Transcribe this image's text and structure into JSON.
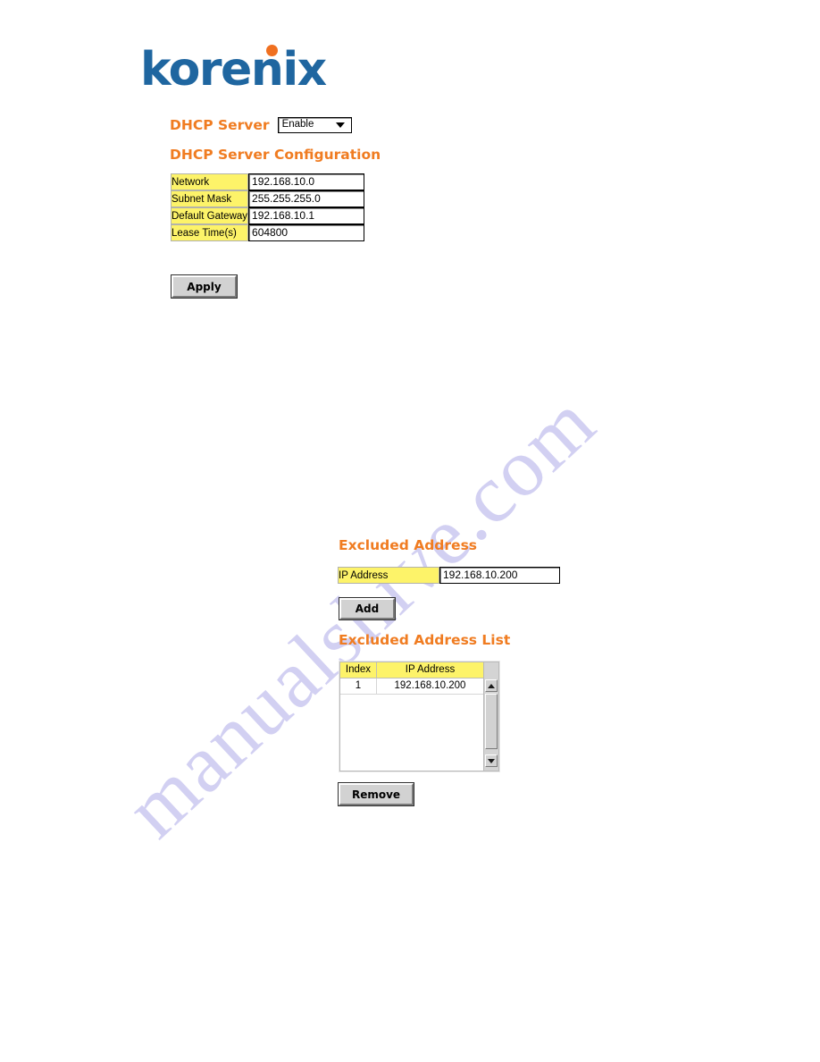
{
  "brand": {
    "logo_text": "korenix",
    "logo_blue": "#1f66a0",
    "logo_dot_color": "#f07020"
  },
  "watermark": {
    "text": "manualshive.com",
    "color": "#d2d0f2"
  },
  "theme": {
    "heading_orange": "#f07c21",
    "label_yellow": "#fdf369",
    "button_face": "#d2d2d2"
  },
  "dhcp_server": {
    "label": "DHCP Server",
    "select_value": "Enable",
    "options": [
      "Enable"
    ]
  },
  "dhcp_config": {
    "title": "DHCP Server Configuration",
    "rows": [
      {
        "label": "Network",
        "value": "192.168.10.0"
      },
      {
        "label": "Subnet Mask",
        "value": "255.255.255.0"
      },
      {
        "label": "Default Gateway",
        "value": "192.168.10.1"
      },
      {
        "label": "Lease Time(s)",
        "value": "604800"
      }
    ],
    "apply_label": "Apply"
  },
  "excluded_address": {
    "title": "Excluded Address",
    "ip_label": "IP Address",
    "ip_value": "192.168.10.200",
    "add_label": "Add"
  },
  "excluded_list": {
    "title": "Excluded Address List",
    "columns": [
      "Index",
      "IP Address"
    ],
    "rows": [
      {
        "index": "1",
        "ip": "192.168.10.200"
      }
    ],
    "remove_label": "Remove",
    "scroll_up_icon": "triangle-up-icon",
    "scroll_down_icon": "triangle-down-icon"
  }
}
